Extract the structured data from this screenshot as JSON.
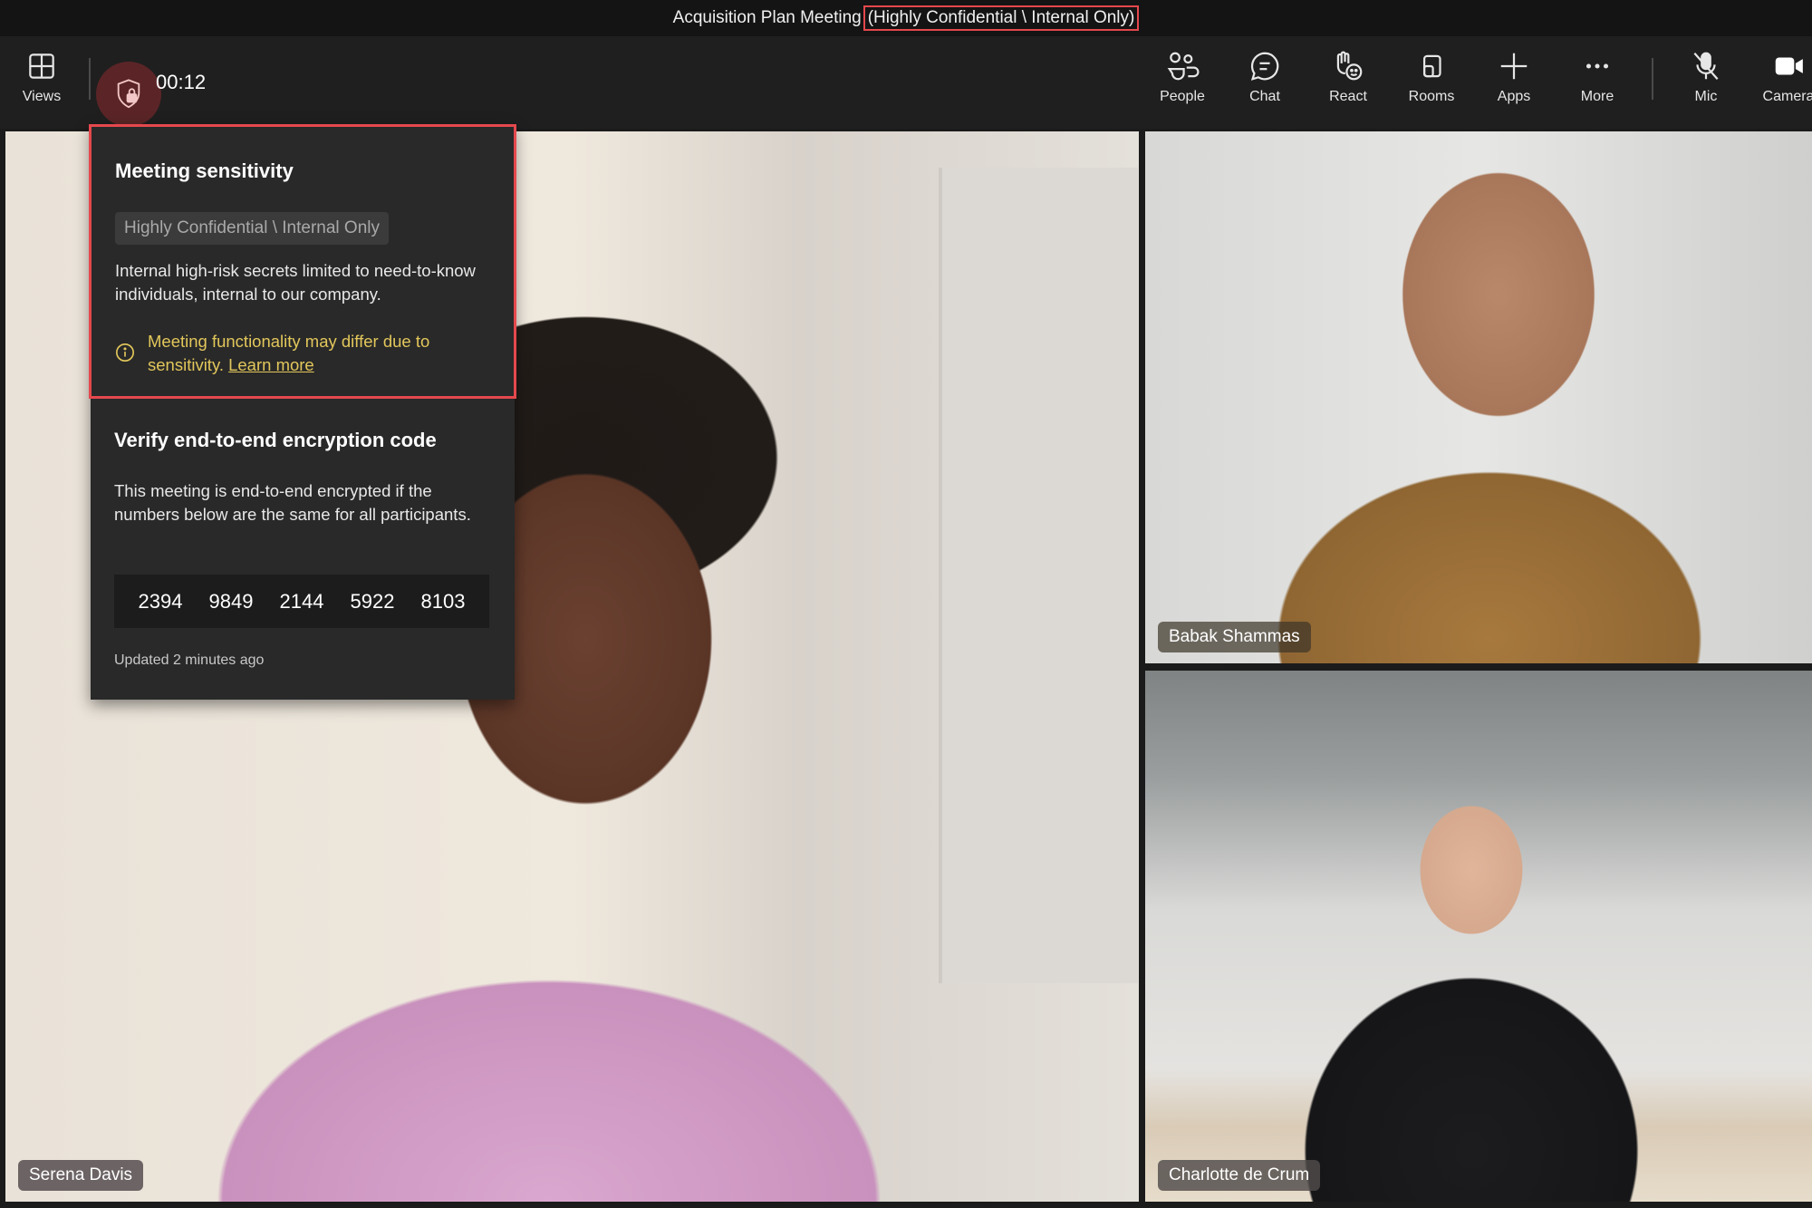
{
  "window": {
    "meeting_title": "Acquisition Plan Meeting",
    "sensitivity_label": "(Highly Confidential \\ Internal Only)"
  },
  "toolbar": {
    "views_label": "Views",
    "timer": "00:12",
    "items": [
      {
        "label": "People",
        "icon": "people-icon"
      },
      {
        "label": "Chat",
        "icon": "chat-icon"
      },
      {
        "label": "React",
        "icon": "react-icon"
      },
      {
        "label": "Rooms",
        "icon": "rooms-icon"
      },
      {
        "label": "Apps",
        "icon": "plus-icon"
      },
      {
        "label": "More",
        "icon": "more-icon"
      },
      {
        "label": "Mic",
        "icon": "mic-off-icon"
      },
      {
        "label": "Camera",
        "icon": "camera-icon"
      }
    ]
  },
  "popover": {
    "sensitivity": {
      "heading": "Meeting sensitivity",
      "badge": "Highly Confidential \\ Internal Only",
      "description": "Internal high-risk secrets limited to need-to-know individuals, internal to our company.",
      "warning": "Meeting functionality may differ due to sensitivity.",
      "learn_more": "Learn more"
    },
    "encryption": {
      "heading": "Verify end-to-end encryption code",
      "description": "This meeting is end-to-end encrypted if the numbers below are the same for all participants.",
      "codes": [
        "2394",
        "9849",
        "2144",
        "5922",
        "8103"
      ],
      "updated": "Updated 2 minutes ago"
    }
  },
  "participants": [
    {
      "name": "Serena Davis"
    },
    {
      "name": "Babak Shammas"
    },
    {
      "name": "Charlotte de Crum"
    }
  ],
  "colors": {
    "highlight": "#e5484d",
    "warning": "#e2c75b"
  }
}
